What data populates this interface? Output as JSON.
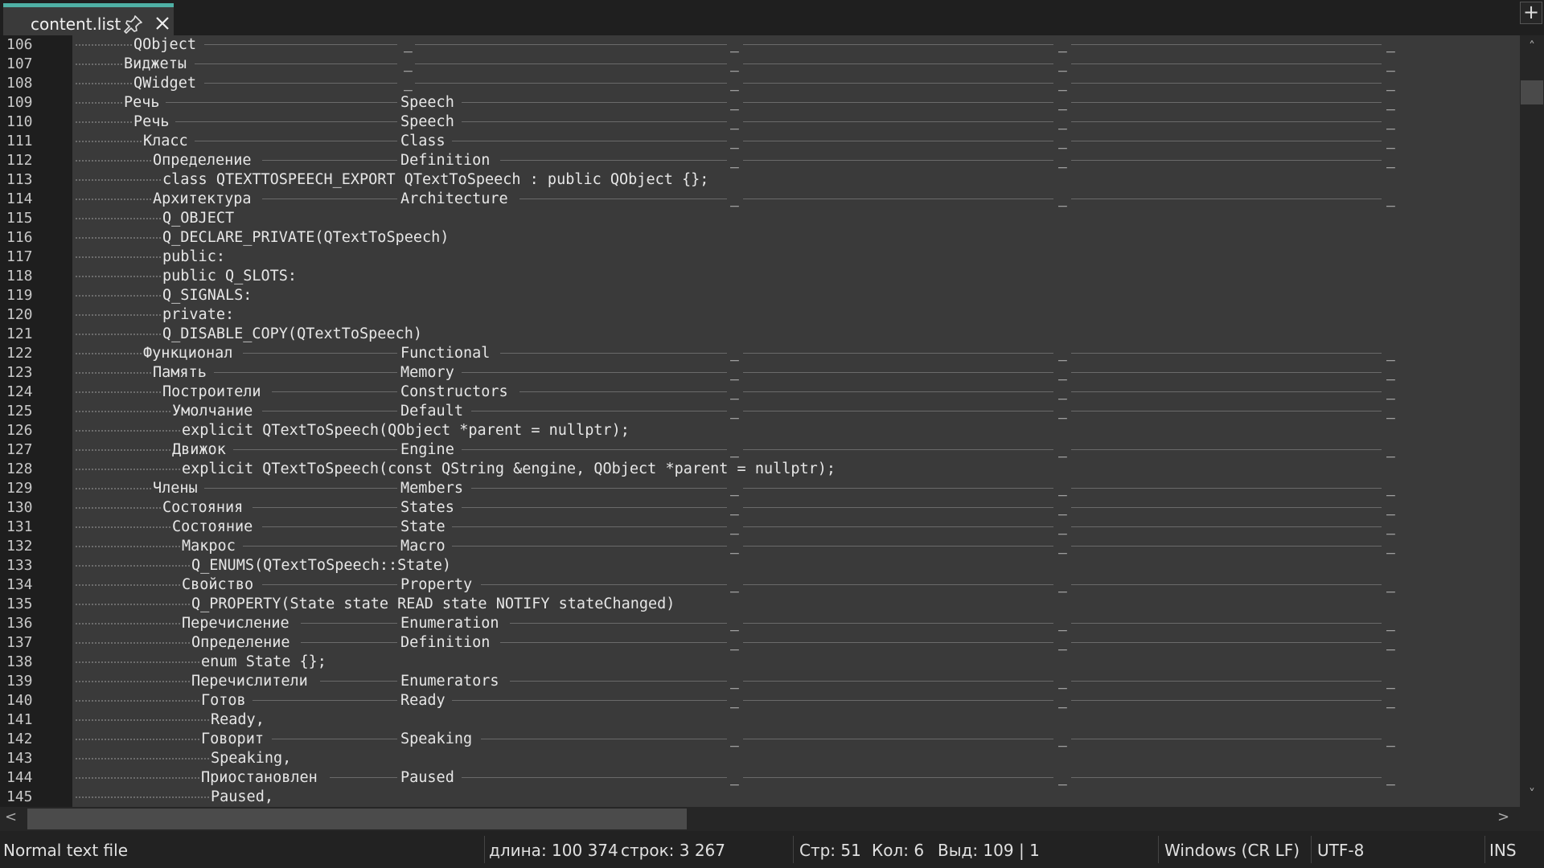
{
  "tab": {
    "title": "content.list",
    "pin_icon": "pin-icon",
    "close_icon": "close-icon"
  },
  "add_tab_label": "+",
  "lines": [
    {
      "n": "106",
      "indent": 6,
      "text": "QObject",
      "col2": "_",
      "rules": true
    },
    {
      "n": "107",
      "indent": 5,
      "text": "Виджеты",
      "col2": "_",
      "rules": true
    },
    {
      "n": "108",
      "indent": 6,
      "text": "QWidget",
      "col2": "_",
      "rules": true
    },
    {
      "n": "109",
      "indent": 5,
      "text": "Речь",
      "col2": "Speech",
      "rules": true
    },
    {
      "n": "110",
      "indent": 6,
      "text": "Речь",
      "col2": "Speech",
      "rules": true
    },
    {
      "n": "111",
      "indent": 7,
      "text": "Класс",
      "col2": "Class",
      "rules": true
    },
    {
      "n": "112",
      "indent": 8,
      "text": "Определение",
      "col2": "Definition",
      "rules": true
    },
    {
      "n": "113",
      "indent": 9,
      "text": "class QTEXTTOSPEECH_EXPORT QTextToSpeech : public QObject {};",
      "col2": "",
      "rules": false
    },
    {
      "n": "114",
      "indent": 8,
      "text": "Архитектура",
      "col2": "Architecture",
      "rules": true
    },
    {
      "n": "115",
      "indent": 9,
      "text": "Q_OBJECT",
      "col2": "",
      "rules": false
    },
    {
      "n": "116",
      "indent": 9,
      "text": "Q_DECLARE_PRIVATE(QTextToSpeech)",
      "col2": "",
      "rules": false
    },
    {
      "n": "117",
      "indent": 9,
      "text": "public:",
      "col2": "",
      "rules": false
    },
    {
      "n": "118",
      "indent": 9,
      "text": "public Q_SLOTS:",
      "col2": "",
      "rules": false
    },
    {
      "n": "119",
      "indent": 9,
      "text": "Q_SIGNALS:",
      "col2": "",
      "rules": false
    },
    {
      "n": "120",
      "indent": 9,
      "text": "private:",
      "col2": "",
      "rules": false
    },
    {
      "n": "121",
      "indent": 9,
      "text": "Q_DISABLE_COPY(QTextToSpeech)",
      "col2": "",
      "rules": false
    },
    {
      "n": "122",
      "indent": 7,
      "text": "Функционал",
      "col2": "Functional",
      "rules": true
    },
    {
      "n": "123",
      "indent": 8,
      "text": "Память",
      "col2": "Memory",
      "rules": true
    },
    {
      "n": "124",
      "indent": 9,
      "text": "Построители",
      "col2": "Constructors",
      "rules": true
    },
    {
      "n": "125",
      "indent": 10,
      "text": "Умолчание",
      "col2": "Default",
      "rules": true
    },
    {
      "n": "126",
      "indent": 11,
      "text": "explicit QTextToSpeech(QObject *parent = nullptr);",
      "col2": "",
      "rules": false
    },
    {
      "n": "127",
      "indent": 10,
      "text": "Движок",
      "col2": "Engine",
      "rules": true
    },
    {
      "n": "128",
      "indent": 11,
      "text": "explicit QTextToSpeech(const QString &engine, QObject *parent = nullptr);",
      "col2": "",
      "rules": false
    },
    {
      "n": "129",
      "indent": 8,
      "text": "Члены",
      "col2": "Members",
      "rules": true
    },
    {
      "n": "130",
      "indent": 9,
      "text": "Состояния",
      "col2": "States",
      "rules": true
    },
    {
      "n": "131",
      "indent": 10,
      "text": "Состояние",
      "col2": "State",
      "rules": true
    },
    {
      "n": "132",
      "indent": 11,
      "text": "Макрос",
      "col2": "Macro",
      "rules": true
    },
    {
      "n": "133",
      "indent": 12,
      "text": "Q_ENUMS(QTextToSpeech::State)",
      "col2": "",
      "rules": false
    },
    {
      "n": "134",
      "indent": 11,
      "text": "Свойство",
      "col2": "Property",
      "rules": true
    },
    {
      "n": "135",
      "indent": 12,
      "text": "Q_PROPERTY(State state READ state NOTIFY stateChanged)",
      "col2": "",
      "rules": false
    },
    {
      "n": "136",
      "indent": 11,
      "text": "Перечисление",
      "col2": "Enumeration",
      "rules": true
    },
    {
      "n": "137",
      "indent": 12,
      "text": "Определение",
      "col2": "Definition",
      "rules": true
    },
    {
      "n": "138",
      "indent": 13,
      "text": "enum State {};",
      "col2": "",
      "rules": false
    },
    {
      "n": "139",
      "indent": 12,
      "text": "Перечислители",
      "col2": "Enumerators",
      "rules": true
    },
    {
      "n": "140",
      "indent": 13,
      "text": "Готов",
      "col2": "Ready",
      "rules": true
    },
    {
      "n": "141",
      "indent": 14,
      "text": "Ready,",
      "col2": "",
      "rules": false
    },
    {
      "n": "142",
      "indent": 13,
      "text": "Говорит",
      "col2": "Speaking",
      "rules": true
    },
    {
      "n": "143",
      "indent": 14,
      "text": "Speaking,",
      "col2": "",
      "rules": false
    },
    {
      "n": "144",
      "indent": 13,
      "text": "Приостановлен",
      "col2": "Paused",
      "rules": true
    },
    {
      "n": "145",
      "indent": 14,
      "text": "Paused,",
      "col2": "",
      "rules": false
    }
  ],
  "underscore": "_",
  "scroll": {
    "up": "˄",
    "down": "˅",
    "left": "<",
    "right": ">"
  },
  "status": {
    "file_type": "Normal text file",
    "length": "длина: 100 374",
    "lines_count": "строк: 3 267",
    "row": "Стр: 51",
    "col": "Кол: 6",
    "sel": "Выд: 109 | 1",
    "eol": "Windows (CR LF)",
    "encoding": "UTF-8",
    "mode": "INS"
  }
}
